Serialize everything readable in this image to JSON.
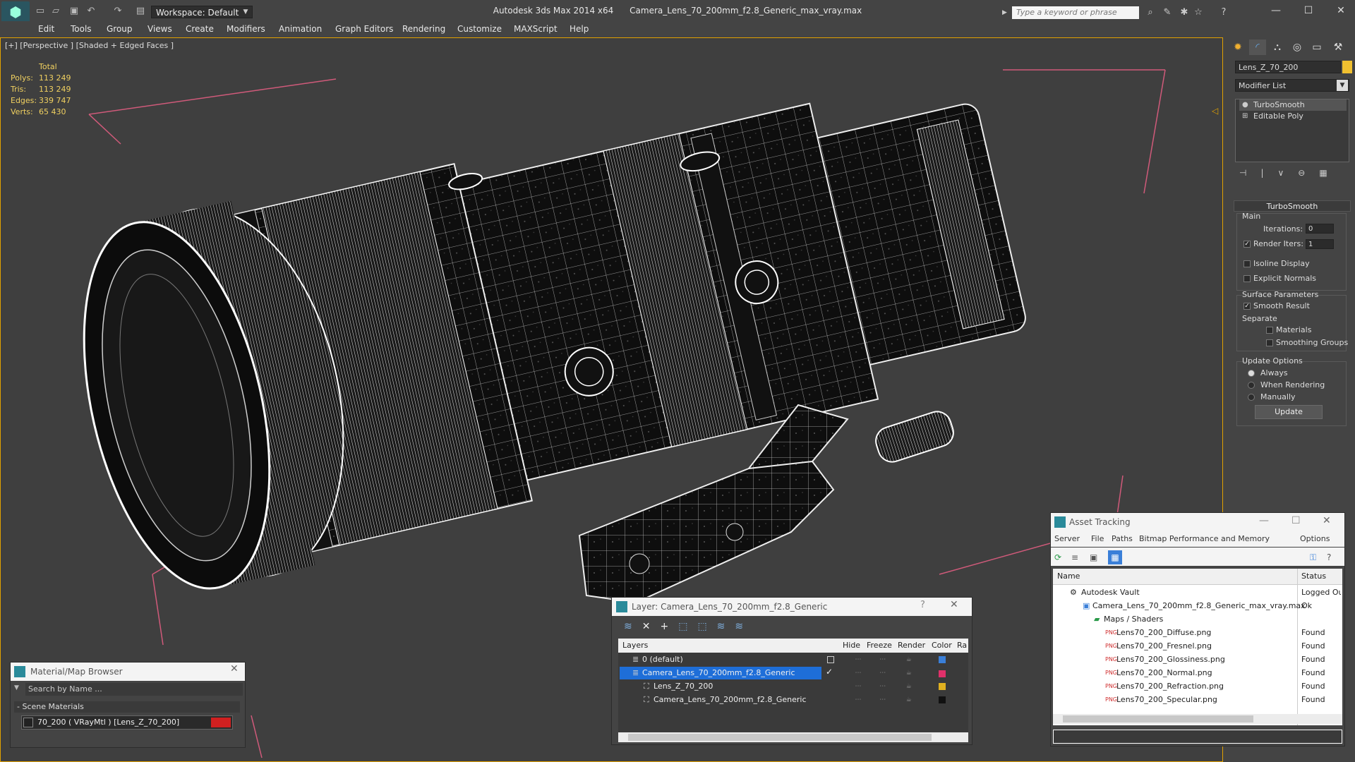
{
  "title_bar": {
    "app_title": "Autodesk 3ds Max  2014 x64",
    "file_name": "Camera_Lens_70_200mm_f2.8_Generic_max_vray.max",
    "workspace": "Workspace: Default",
    "search_placeholder": "Type a keyword or phrase"
  },
  "menu": [
    "Edit",
    "Tools",
    "Group",
    "Views",
    "Create",
    "Modifiers",
    "Animation",
    "Graph Editors",
    "Rendering",
    "Customize",
    "MAXScript",
    "Help"
  ],
  "viewport": {
    "label": "[+] [Perspective ] [Shaded + Edged Faces ]",
    "stats": {
      "total_label": "Total",
      "polys_label": "Polys:",
      "polys": "113 249",
      "tris_label": "Tris:",
      "tris": "113 249",
      "edges_label": "Edges:",
      "edges": "339 747",
      "verts_label": "Verts:",
      "verts": "65 430"
    }
  },
  "command_panel": {
    "object_name": "Lens_Z_70_200",
    "object_color": "#f0c030",
    "modifier_list": "Modifier List",
    "stack": [
      "TurboSmooth",
      "Editable Poly"
    ],
    "rollout_title": "TurboSmooth",
    "main_label": "Main",
    "iterations_label": "Iterations:",
    "iterations": "0",
    "render_iters_label": "Render Iters:",
    "render_iters": "1",
    "render_iters_checked": true,
    "isoline_label": "Isoline Display",
    "explicit_label": "Explicit Normals",
    "surface_label": "Surface Parameters",
    "smooth_result_label": "Smooth Result",
    "separate_label": "Separate",
    "materials_label": "Materials",
    "smoothing_groups_label": "Smoothing Groups",
    "update_options_label": "Update Options",
    "always_label": "Always",
    "when_rendering_label": "When Rendering",
    "manually_label": "Manually",
    "update_button": "Update"
  },
  "material_browser": {
    "title": "Material/Map Browser",
    "search_placeholder": "Search by Name ...",
    "section": "- Scene Materials",
    "item": "70_200  ( VRayMtl ) [Lens_Z_70_200]"
  },
  "layer_panel": {
    "title": "Layer: Camera_Lens_70_200mm_f2.8_Generic",
    "columns": [
      "Layers",
      "Hide",
      "Freeze",
      "Render",
      "Color",
      "Ra"
    ],
    "rows": [
      {
        "name": "0 (default)",
        "color": "#3a7fd8"
      },
      {
        "name": "Camera_Lens_70_200mm_f2.8_Generic",
        "color": "#e0306a"
      },
      {
        "name": "Lens_Z_70_200",
        "color": "#e0b020"
      },
      {
        "name": "Camera_Lens_70_200mm_f2.8_Generic",
        "color": "#111111"
      }
    ]
  },
  "asset_tracking": {
    "title": "Asset Tracking",
    "menu": [
      "Server",
      "File",
      "Paths",
      "Bitmap Performance and Memory",
      "Options"
    ],
    "columns": [
      "Name",
      "Status"
    ],
    "rows": [
      {
        "name": "Autodesk Vault",
        "status": "Logged Ou"
      },
      {
        "name": "Camera_Lens_70_200mm_f2.8_Generic_max_vray.max",
        "status": "Ok"
      },
      {
        "name": "Maps / Shaders",
        "status": ""
      },
      {
        "name": "Lens70_200_Diffuse.png",
        "status": "Found"
      },
      {
        "name": "Lens70_200_Fresnel.png",
        "status": "Found"
      },
      {
        "name": "Lens70_200_Glossiness.png",
        "status": "Found"
      },
      {
        "name": "Lens70_200_Normal.png",
        "status": "Found"
      },
      {
        "name": "Lens70_200_Refraction.png",
        "status": "Found"
      },
      {
        "name": "Lens70_200_Specular.png",
        "status": "Found"
      }
    ]
  }
}
